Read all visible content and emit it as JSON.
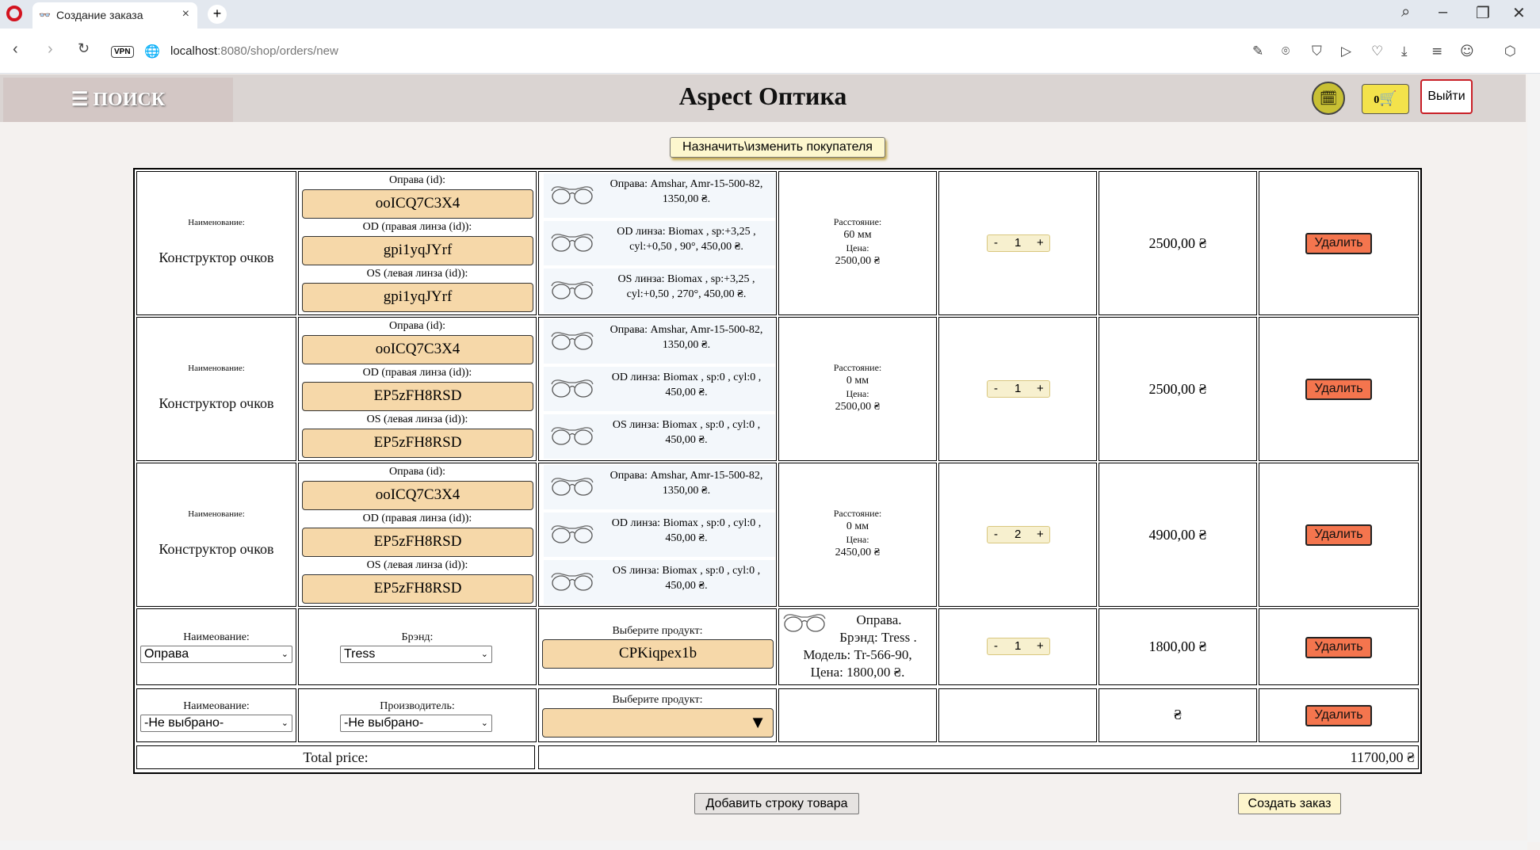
{
  "browser": {
    "tab_title": "Создание заказа",
    "url_host": "localhost",
    "url_path": ":8080/shop/orders/new",
    "vpn_label": "VPN"
  },
  "header": {
    "search_label": "☰ ПОИСК",
    "brand": "Aspect Оптика",
    "logout_label": "Выйти",
    "cart_count": "0"
  },
  "assign_customer_label": "Назначить\\изменить покупателя",
  "constructor_rows": [
    {
      "name_label": "Наименование:",
      "name_value": "Конструктор очков",
      "frame_label": "Оправа (id):",
      "frame_id": "ooICQ7C3X4",
      "od_label": "OD (правая линза (id)):",
      "od_id": "gpi1yqJYrf",
      "os_label": "OS (левая линза (id)):",
      "os_id": "gpi1yqJYrf",
      "frame_desc": "Оправа: Amshar, Amr-15-500-82, 1350,00 ₴.",
      "od_desc": "OD линза: Biomax , sp:+3,25 , cyl:+0,50 , 90°, 450,00 ₴.",
      "os_desc": "OS линза: Biomax , sp:+3,25 , cyl:+0,50 , 270°, 450,00 ₴.",
      "distance_label": "Расстояние:",
      "distance_value": "60 мм",
      "unit_price_label": "Цена:",
      "unit_price": "2500,00 ₴",
      "qty": "1",
      "total": "2500,00 ₴",
      "delete_label": "Удалить"
    },
    {
      "name_label": "Наименование:",
      "name_value": "Конструктор очков",
      "frame_label": "Оправа (id):",
      "frame_id": "ooICQ7C3X4",
      "od_label": "OD (правая линза (id)):",
      "od_id": "EP5zFH8RSD",
      "os_label": "OS (левая линза (id)):",
      "os_id": "EP5zFH8RSD",
      "frame_desc": "Оправа: Amshar, Amr-15-500-82, 1350,00 ₴.",
      "od_desc": "OD линза: Biomax , sp:0 , cyl:0 , 450,00 ₴.",
      "os_desc": "OS линза: Biomax , sp:0 , cyl:0 , 450,00 ₴.",
      "distance_label": "Расстояние:",
      "distance_value": "0 мм",
      "unit_price_label": "Цена:",
      "unit_price": "2500,00 ₴",
      "qty": "1",
      "total": "2500,00 ₴",
      "delete_label": "Удалить"
    },
    {
      "name_label": "Наименование:",
      "name_value": "Конструктор очков",
      "frame_label": "Оправа (id):",
      "frame_id": "ooICQ7C3X4",
      "od_label": "OD (правая линза (id)):",
      "od_id": "EP5zFH8RSD",
      "os_label": "OS (левая линза (id)):",
      "os_id": "EP5zFH8RSD",
      "frame_desc": "Оправа: Amshar, Amr-15-500-82, 1350,00 ₴.",
      "od_desc": "OD линза: Biomax , sp:0 , cyl:0 , 450,00 ₴.",
      "os_desc": "OS линза: Biomax , sp:0 , cyl:0 , 450,00 ₴.",
      "distance_label": "Расстояние:",
      "distance_value": "0 мм",
      "unit_price_label": "Цена:",
      "unit_price": "2450,00 ₴",
      "qty": "2",
      "total": "4900,00 ₴",
      "delete_label": "Удалить"
    }
  ],
  "product_row": {
    "name_label": "Наимеование:",
    "name_select": "Оправа",
    "brand_label": "Брэнд:",
    "brand_select": "Tress",
    "choose_label": "Выберите продукт:",
    "product_id": "CPKiqpex1b",
    "desc_line1": "Оправа.",
    "desc_line2": "Брэнд: Tress .",
    "desc_line3": "Модель: Tr-566-90,",
    "desc_line4": "Цена: 1800,00 ₴.",
    "qty": "1",
    "total": "1800,00 ₴",
    "delete_label": "Удалить"
  },
  "empty_row": {
    "name_label": "Наимеование:",
    "name_select": "-Не выбрано-",
    "maker_label": "Производитель:",
    "maker_select": "-Не выбрано-",
    "choose_label": "Выберите продукт:",
    "dropdown_arrow": "▼",
    "total": "₴",
    "delete_label": "Удалить"
  },
  "total_row": {
    "label": "Total price:",
    "value": "11700,00 ₴"
  },
  "add_row_label": "Добавить строку товара",
  "create_order_label": "Создать заказ",
  "stepper": {
    "minus": "-",
    "plus": "+"
  }
}
